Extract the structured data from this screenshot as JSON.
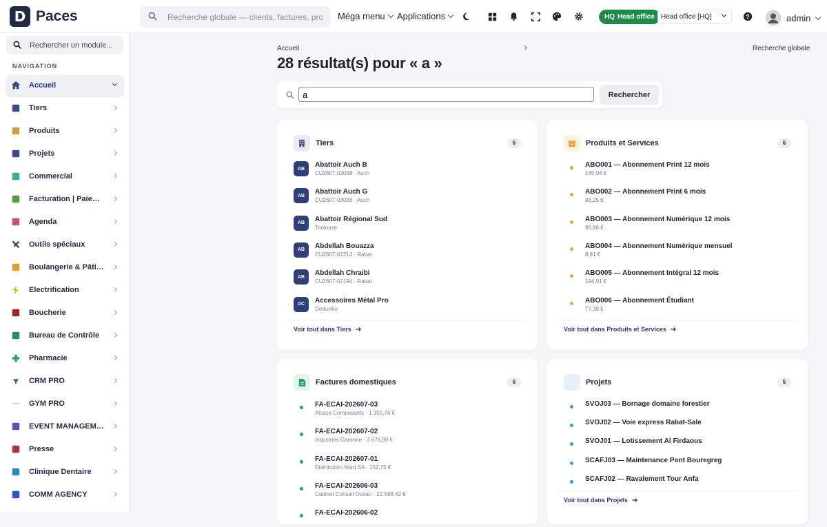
{
  "app": {
    "logo_letter": "D",
    "name": "Paces"
  },
  "topbar": {
    "search_placeholder": "Recherche globale — clients, factures, produits…",
    "mega_menu": "Méga menu",
    "applications": "Applications",
    "hq_badge_prefix": "HQ",
    "hq_badge_label": "Head office",
    "office_select": "Head office [HQ]",
    "user_name": "admin"
  },
  "sidebar": {
    "search_placeholder": "Rechercher un module...",
    "nav_label": "NAVIGATION",
    "items": [
      {
        "label": "Accueil",
        "icon": "home-icon",
        "color": "#3b4a8a"
      },
      {
        "label": "Tiers",
        "icon": "building-icon",
        "color": "#3b4a8a"
      },
      {
        "label": "Produits",
        "icon": "box-icon",
        "color": "#c9a23a"
      },
      {
        "label": "Projets",
        "icon": "project-icon",
        "color": "#3b4a8a"
      },
      {
        "label": "Commercial",
        "icon": "shop-icon",
        "color": "#3aa8a0"
      },
      {
        "label": "Facturation | Paiement",
        "icon": "invoice-icon",
        "color": "#5a9a3a"
      },
      {
        "label": "Agenda",
        "icon": "calendar-icon",
        "color": "#c0567a"
      },
      {
        "label": "Outils spéciaux",
        "icon": "tools-icon",
        "color": "#3b4a6a"
      },
      {
        "label": "Boulangerie & Pâtisserie",
        "icon": "bread-icon",
        "color": "#e0a030"
      },
      {
        "label": "Electrification",
        "icon": "bolt-icon",
        "color": "#e6b800"
      },
      {
        "label": "Boucherie",
        "icon": "meat-icon",
        "color": "#9a2a2a"
      },
      {
        "label": "Bureau de Contrôle",
        "icon": "inspection-icon",
        "color": "#2a8a7a"
      },
      {
        "label": "Pharmacie",
        "icon": "cross-icon",
        "color": "#2aa060"
      },
      {
        "label": "CRM PRO",
        "icon": "funnel-icon",
        "color": "#2a5ac0"
      },
      {
        "label": "GYM PRO",
        "icon": "dumbbell-icon",
        "color": "#999999"
      },
      {
        "label": "EVENT MANAGEMENT",
        "icon": "event-icon",
        "color": "#6a4ac0"
      },
      {
        "label": "Presse",
        "icon": "newspaper-icon",
        "color": "#a03a3a"
      },
      {
        "label": "Clinique Dentaire",
        "icon": "tooth-icon",
        "color": "#2a8ac0"
      },
      {
        "label": "COMM AGENCY",
        "icon": "megaphone-icon",
        "color": "#2a5ac0"
      }
    ]
  },
  "main": {
    "breadcrumb": "Accueil",
    "breadcrumb_right": "Recherche globale",
    "title": "28 résultat(s) pour « a »",
    "search_value": "a",
    "search_button": "Rechercher"
  },
  "cards": {
    "tiers": {
      "title": "Tiers",
      "count": "6",
      "link": "Voir tout dans Tiers",
      "rows": [
        {
          "badge": "AB",
          "title": "Abattoir Auch B",
          "sub": "CU2607-03098 · Auch"
        },
        {
          "badge": "AB",
          "title": "Abattoir Auch G",
          "sub": "CU2607-03088 · Auch"
        },
        {
          "badge": "AB",
          "title": "Abattoir Régional Sud",
          "sub": "Toulouse"
        },
        {
          "badge": "AB",
          "title": "Abdellah Bouazza",
          "sub": "CU2607-02214 · Rabat"
        },
        {
          "badge": "AB",
          "title": "Abdellah Chraibi",
          "sub": "CU2607-02194 · Rabat"
        },
        {
          "badge": "AC",
          "title": "Accessoires Métal Pro",
          "sub": "Deauville"
        }
      ]
    },
    "produits": {
      "title": "Produits et Services",
      "count": "6",
      "link": "Voir tout dans Produits et Services",
      "dot_color": "#f0a040",
      "rows": [
        {
          "title": "ABO001 — Abonnement Print 12 mois",
          "sub": "145,94 €"
        },
        {
          "title": "ABO002 — Abonnement Print 6 mois",
          "sub": "83,25 €"
        },
        {
          "title": "ABO003 — Abonnement Numérique 12 mois",
          "sub": "96,96 €"
        },
        {
          "title": "ABO004 — Abonnement Numérique mensuel",
          "sub": "8,81 €"
        },
        {
          "title": "ABO005 — Abonnement Intégral 12 mois",
          "sub": "194,91 €"
        },
        {
          "title": "ABO006 — Abonnement Étudiant",
          "sub": "77,38 €"
        }
      ]
    },
    "factures": {
      "title": "Factures domestiques",
      "count": "6",
      "dot_color": "#2aa060",
      "rows": [
        {
          "title": "FA-ECAI-202607-03",
          "sub": "Alsace Composants · 1 355,74 €"
        },
        {
          "title": "FA-ECAI-202607-02",
          "sub": "Industries Garonne · 3 676,98 €"
        },
        {
          "title": "FA-ECAI-202607-01",
          "sub": "Distribution Nord SA · 152,75 €"
        },
        {
          "title": "FA-ECAI-202606-03",
          "sub": "Cabinet Conseil Océan · 22 588,42 €"
        },
        {
          "title": "FA-ECAI-202606-02",
          "sub": ""
        }
      ]
    },
    "projets": {
      "title": "Projets",
      "count": "5",
      "link": "Voir tout dans Projets",
      "dot_color": "#3a9ad9",
      "rows": [
        {
          "title": "SVOJ03 — Bornage domaine forestier"
        },
        {
          "title": "SVOJ02 — Voie express Rabat-Sale"
        },
        {
          "title": "SVOJ01 — Lotissement Al Firdaous"
        },
        {
          "title": "SCAFJ03 — Maintenance Pont Bouregreg"
        },
        {
          "title": "SCAFJ02 — Ravalement Tour Anfa"
        }
      ]
    }
  }
}
